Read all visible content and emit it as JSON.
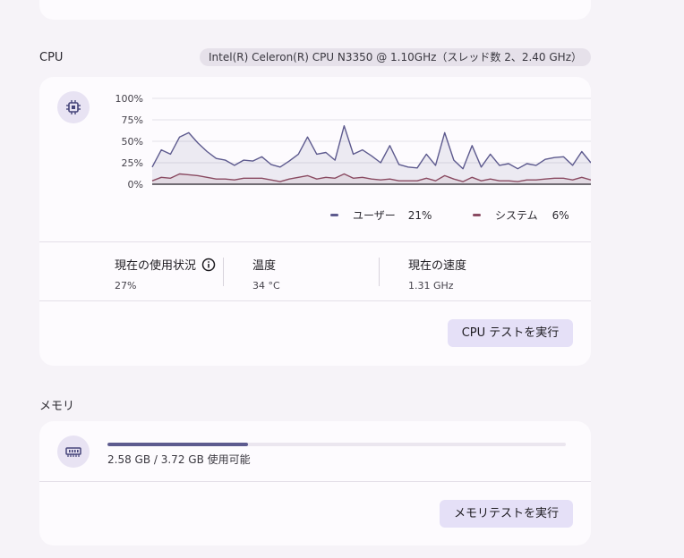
{
  "cpu": {
    "title": "CPU",
    "model": "Intel(R) Celeron(R) CPU N3350 @ 1.10GHz（スレッド数 2、2.40 GHz）",
    "icon": "processor-icon",
    "chart_data": {
      "type": "area",
      "y_ticks": [
        "100%",
        "75%",
        "50%",
        "25%",
        "0%"
      ],
      "ylim": [
        0,
        100
      ],
      "grid": true,
      "series": [
        {
          "name": "ユーザー",
          "color": "#5d5a8e",
          "values": [
            20,
            40,
            35,
            55,
            60,
            48,
            38,
            30,
            28,
            22,
            28,
            27,
            32,
            23,
            20,
            27,
            35,
            55,
            35,
            37,
            28,
            68,
            35,
            40,
            33,
            25,
            45,
            23,
            20,
            19,
            35,
            22,
            60,
            28,
            18,
            45,
            20,
            35,
            22,
            24,
            18,
            24,
            22,
            29,
            31,
            32,
            22,
            38,
            25
          ]
        },
        {
          "name": "システム",
          "color": "#8a4b62",
          "values": [
            4,
            8,
            7,
            12,
            11,
            10,
            8,
            6,
            6,
            5,
            7,
            7,
            7,
            5,
            3,
            6,
            8,
            10,
            6,
            8,
            7,
            12,
            7,
            8,
            6,
            5,
            6,
            4,
            4,
            4,
            7,
            4,
            10,
            6,
            3,
            8,
            4,
            6,
            4,
            4,
            3,
            5,
            5,
            6,
            7,
            7,
            5,
            8,
            5
          ]
        }
      ]
    },
    "legend": [
      {
        "label": "ユーザー",
        "value": "21%",
        "color": "#5d5a8e"
      },
      {
        "label": "システム",
        "value": "6%",
        "color": "#8a4b62"
      }
    ],
    "stats": {
      "usage_label": "現在の使用状況",
      "usage_value": "27%",
      "temp_label": "温度",
      "temp_value": "34 °C",
      "speed_label": "現在の速度",
      "speed_value": "1.31 GHz"
    },
    "run_test_label": "CPU テストを実行"
  },
  "memory": {
    "title": "メモリ",
    "icon": "memory-chip-icon",
    "used_fraction": 0.306,
    "usage_text": "2.58 GB / 3.72 GB 使用可能",
    "run_test_label": "メモリテストを実行"
  }
}
